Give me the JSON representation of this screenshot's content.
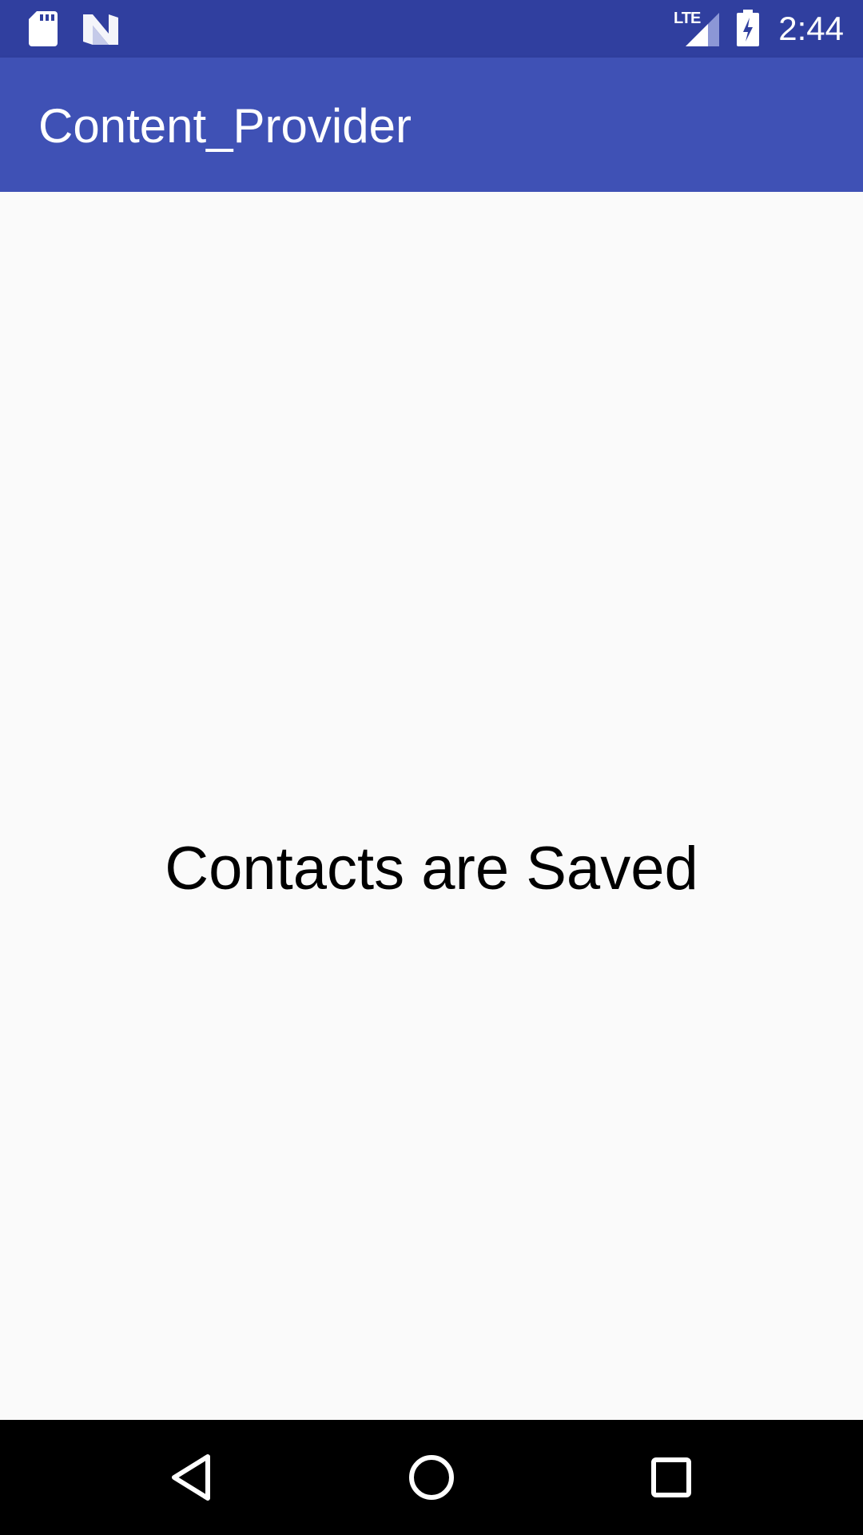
{
  "status_bar": {
    "network_label": "LTE",
    "time": "2:44",
    "icons": [
      "sd-card-icon",
      "n-notification-icon",
      "lte-signal-icon",
      "battery-charging-icon"
    ]
  },
  "app_bar": {
    "title": "Content_Provider"
  },
  "main": {
    "message": "Contacts are Saved"
  },
  "nav_bar": {
    "buttons": [
      "back-icon",
      "home-icon",
      "recents-icon"
    ]
  },
  "colors": {
    "status_bar": "#303f9f",
    "app_bar": "#3f51b5",
    "background": "#fafafa",
    "nav_bar": "#000000"
  }
}
